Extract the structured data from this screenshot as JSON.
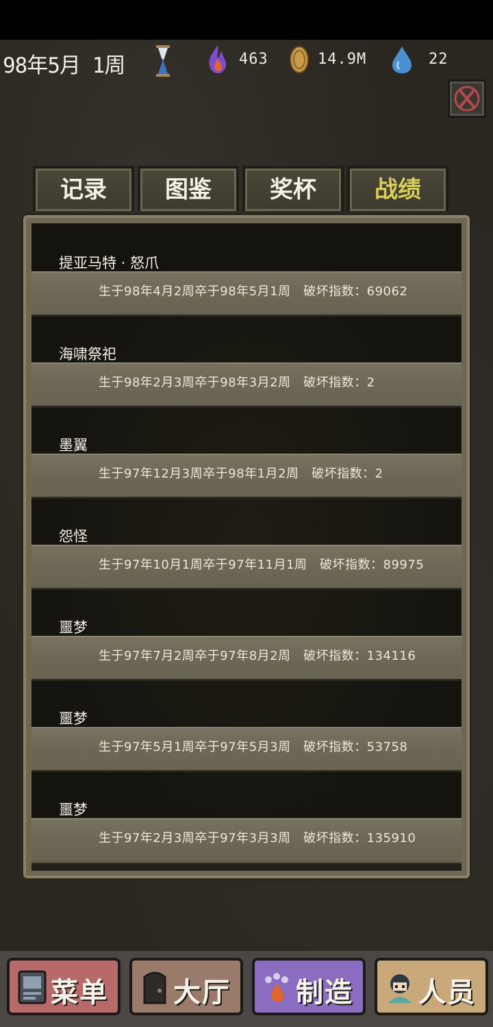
{
  "hud": {
    "date": "98年5月 1周",
    "soul": "463",
    "gold": "14.9M",
    "water": "22"
  },
  "tabs": [
    "记录",
    "图鉴",
    "奖杯",
    "战绩"
  ],
  "active_tab": 3,
  "entries": [
    {
      "name": "提亚马特 · 怒爪",
      "info": "生于98年4月2周卒于98年5月1周　破坏指数：69062"
    },
    {
      "name": "海啸祭祀",
      "info": "生于98年2月3周卒于98年3月2周　破坏指数：2"
    },
    {
      "name": "墨翼",
      "info": "生于97年12月3周卒于98年1月2周　破坏指数：2"
    },
    {
      "name": "怨怪",
      "info": "生于97年10月1周卒于97年11月1周　破坏指数：89975"
    },
    {
      "name": "噩梦",
      "info": "生于97年7月2周卒于97年8月2周　破坏指数：134116"
    },
    {
      "name": "噩梦",
      "info": "生于97年5月1周卒于97年5月3周　破坏指数：53758"
    },
    {
      "name": "噩梦",
      "info": "生于97年2月3周卒于97年3月3周　破坏指数：135910"
    }
  ],
  "nav": {
    "menu": "菜单",
    "hall": "大厅",
    "craft": "制造",
    "staff": "人员"
  },
  "colors": {
    "active_tab": "#d8cf5a",
    "menu_btn": "#b86a6a",
    "hall_btn": "#9a7a6a",
    "craft_btn": "#8a6cc0",
    "staff_btn": "#c9a87a"
  }
}
